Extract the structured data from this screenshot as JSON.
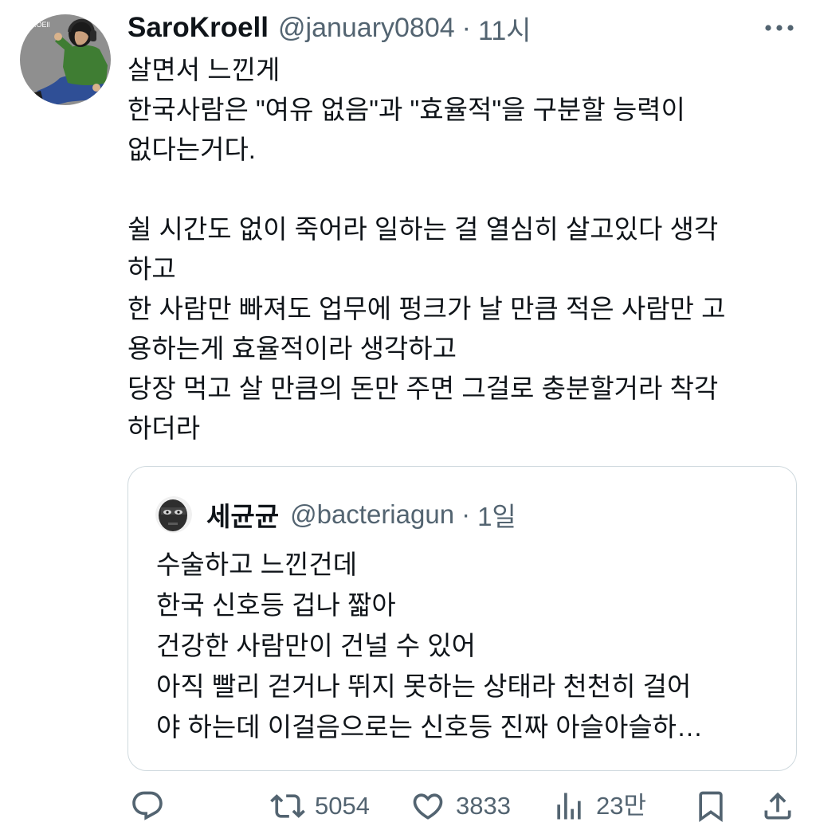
{
  "colors": {
    "text": "#0f1419",
    "secondary": "#536471",
    "border": "#cfd9de",
    "background": "#ffffff"
  },
  "tweet": {
    "author": {
      "name": "SaroKroell",
      "handle": "@january0804",
      "separator": "·",
      "time": "11시",
      "avatar_icon": "user-avatar",
      "avatar_text": "ROEll"
    },
    "more_icon": "more-options-icon",
    "lines": [
      "살면서 느낀게",
      "한국사람은 \"여유 없음\"과 \"효율적\"을 구분할 능력이",
      "없다는거다.",
      "쉴 시간도 없이 죽어라 일하는 걸 열심히 살고있다 생각",
      "하고",
      "한 사람만 빠져도 업무에 펑크가 날 만큼 적은 사람만 고",
      "용하는게 효율적이라 생각하고",
      "당장 먹고 살 만큼의 돈만 주면 그걸로 충분할거라 착각",
      "하더라"
    ],
    "quote": {
      "author": {
        "name": "세균균",
        "handle": "@bacteriagun",
        "separator": "·",
        "time": "1일",
        "avatar_icon": "quoted-user-avatar"
      },
      "lines": [
        "수술하고 느낀건데",
        "한국 신호등 겁나 짧아",
        "건강한 사람만이 건널 수 있어",
        "아직 빨리 걷거나 뛰지 못하는 상태라 천천히 걸어",
        "야 하는데 이걸음으로는 신호등 진짜 아슬아슬하…"
      ]
    },
    "actions": {
      "reply": {
        "icon": "reply-icon"
      },
      "retweet": {
        "icon": "retweet-icon",
        "count": "5054"
      },
      "like": {
        "icon": "heart-icon",
        "count": "3833"
      },
      "views": {
        "icon": "views-icon",
        "count": "23만"
      },
      "bookmark": {
        "icon": "bookmark-icon"
      },
      "share": {
        "icon": "share-icon"
      }
    }
  }
}
